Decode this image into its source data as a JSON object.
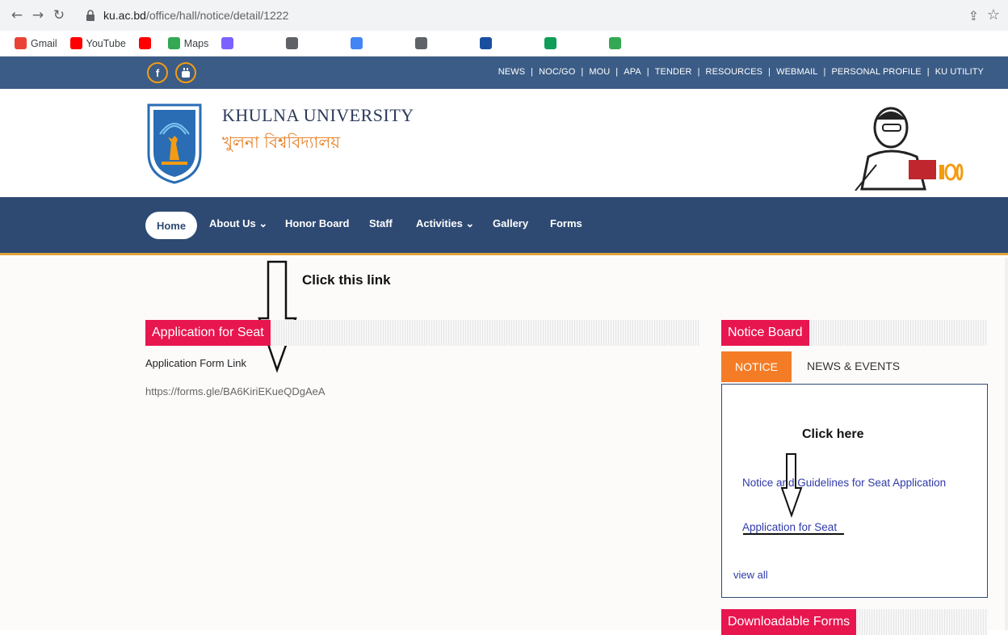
{
  "browser": {
    "url_domain": "ku.ac.bd",
    "url_path": "/office/hall/notice/detail/1222",
    "bookmarks": [
      {
        "label": "Gmail",
        "color": "#ea4335"
      },
      {
        "label": "YouTube",
        "color": "#ff0000"
      },
      {
        "label": "",
        "color": "#ff0000"
      },
      {
        "label": "Maps",
        "color": "#34a853"
      },
      {
        "label": "",
        "color": "#7b61ff"
      },
      {
        "label": "",
        "color": "#5f6368"
      },
      {
        "label": "",
        "color": "#4285f4"
      },
      {
        "label": "",
        "color": "#5f6368"
      },
      {
        "label": "",
        "color": "#1a4fa0"
      },
      {
        "label": "",
        "color": "#0f9d58"
      },
      {
        "label": "",
        "color": "#34a853"
      }
    ]
  },
  "topbar": {
    "links": [
      "NEWS",
      "NOC/GO",
      "MOU",
      "APA",
      "TENDER",
      "RESOURCES",
      "WEBMAIL",
      "PERSONAL PROFILE",
      "KU UTILITY"
    ]
  },
  "header": {
    "name_en": "KHULNA UNIVERSITY",
    "name_bn": "খুলনা বিশ্ববিদ্যালয়"
  },
  "nav": {
    "home": "Home",
    "about": "About Us ⌄",
    "honor": "Honor Board",
    "staff": "Staff",
    "activities": "Activities ⌄",
    "gallery": "Gallery",
    "forms": "Forms"
  },
  "main": {
    "annotation_top": "Click this link",
    "section_title": "Application for Seat",
    "form_label": "Application Form Link",
    "form_url": "https://forms.gle/BA6KiriEKueQDgAeA"
  },
  "sidebar": {
    "notice_board_title": "Notice Board",
    "tab_notice": "NOTICE",
    "tab_news": "NEWS & EVENTS",
    "annotation_here": "Click here",
    "notice_items": [
      "Notice and Guidelines for Seat Application",
      "Application for Seat"
    ],
    "view_all": "view all",
    "downloadable_title": "Downloadable Forms"
  },
  "colors": {
    "topbar": "#3b5c86",
    "nav": "#2e4a73",
    "accent_red": "#e8164f",
    "accent_orange": "#f47c26"
  }
}
